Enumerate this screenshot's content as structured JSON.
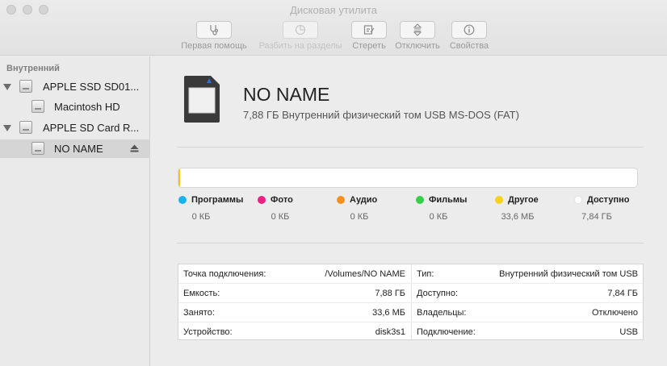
{
  "window": {
    "title": "Дисковая утилита"
  },
  "toolbar": {
    "first_aid": {
      "label": "Первая помощь",
      "icon": "stethoscope-icon"
    },
    "partition": {
      "label": "Разбить на разделы",
      "icon": "pie-icon"
    },
    "erase": {
      "label": "Стереть",
      "icon": "erase-icon"
    },
    "unmount": {
      "label": "Отключить",
      "icon": "unmount-icon"
    },
    "info": {
      "label": "Свойства",
      "icon": "info-icon"
    }
  },
  "sidebar": {
    "section": "Внутренний",
    "items": [
      {
        "label": "APPLE SSD SD01...",
        "icon": "disk-icon"
      },
      {
        "label": "Macintosh HD",
        "icon": "volume-icon"
      },
      {
        "label": "APPLE SD Card R...",
        "icon": "disk-icon"
      },
      {
        "label": "NO NAME",
        "icon": "volume-icon",
        "selected": true
      }
    ]
  },
  "volume": {
    "name": "NO NAME",
    "description": "7,88 ГБ Внутренний физический том USB MS-DOS (FAT)"
  },
  "usage": {
    "used_fraction": 0.004,
    "fill_color": "#f8c412",
    "legend": [
      {
        "label": "Программы",
        "value": "0 КБ",
        "color": "#1ab3f2"
      },
      {
        "label": "Фото",
        "value": "0 КБ",
        "color": "#ee1f86"
      },
      {
        "label": "Аудио",
        "value": "0 КБ",
        "color": "#f5911f"
      },
      {
        "label": "Фильмы",
        "value": "0 КБ",
        "color": "#35d046"
      },
      {
        "label": "Другое",
        "value": "33,6 МБ",
        "color": "#f8d21c"
      },
      {
        "label": "Доступно",
        "value": "7,84 ГБ",
        "color": "#ffffff"
      }
    ]
  },
  "info": {
    "left": [
      {
        "key": "Точка подключения:",
        "value": "/Volumes/NO NAME"
      },
      {
        "key": "Емкость:",
        "value": "7,88 ГБ"
      },
      {
        "key": "Занято:",
        "value": "33,6 МБ"
      },
      {
        "key": "Устройство:",
        "value": "disk3s1"
      }
    ],
    "right": [
      {
        "key": "Тип:",
        "value": "Внутренний физический том USB"
      },
      {
        "key": "Доступно:",
        "value": "7,84 ГБ"
      },
      {
        "key": "Владельцы:",
        "value": "Отключено"
      },
      {
        "key": "Подключение:",
        "value": "USB"
      }
    ]
  }
}
